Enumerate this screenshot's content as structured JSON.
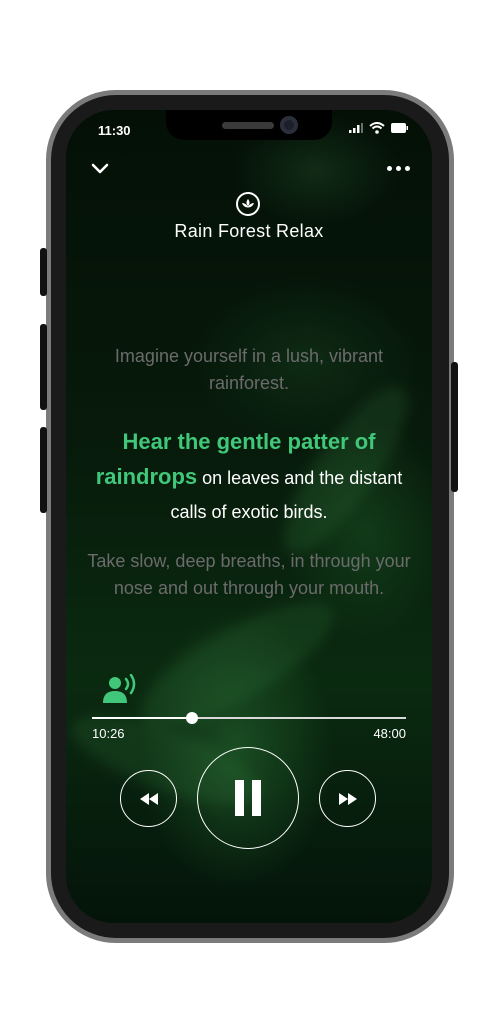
{
  "status_bar": {
    "time": "11:30"
  },
  "header": {
    "title": "Rain Forest Relax"
  },
  "script": {
    "line_prev": "Imagine yourself in a lush, vibrant rainforest.",
    "line_current_highlight": "Hear the gentle patter of raindrops",
    "line_current_rest": " on leaves and the distant calls of exotic birds.",
    "line_next": "Take slow, deep breaths, in through your nose and out through your mouth."
  },
  "player": {
    "elapsed": "10:26",
    "duration": "48:00",
    "progress": 0.32,
    "state": "playing"
  },
  "colors": {
    "accent": "#41c77a",
    "dim_text": "#6b6b6b"
  },
  "icons": {
    "collapse": "chevron-down-icon",
    "more": "more-horizontal-icon",
    "brand": "lotus-logo-icon",
    "narrator": "speaking-person-icon",
    "rewind": "rewind-icon",
    "pause": "pause-icon",
    "fast_forward": "fast-forward-icon"
  }
}
